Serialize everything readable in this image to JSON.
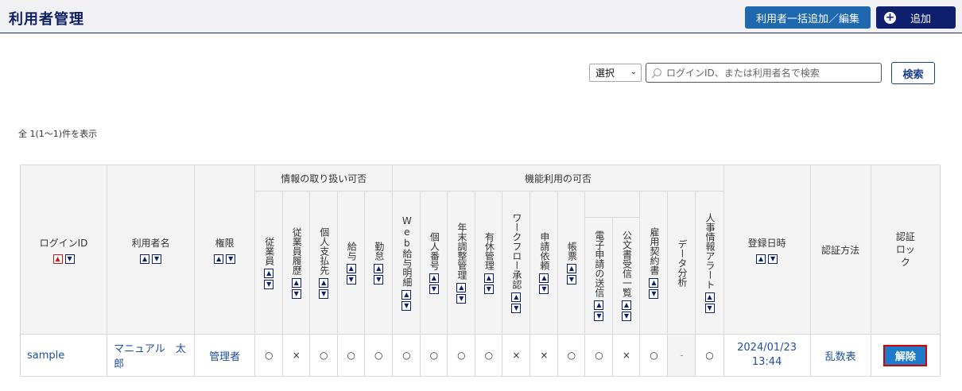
{
  "header": {
    "title": "利用者管理",
    "bulk_button": "利用者一括追加／編集",
    "add_button": "追加",
    "add_icon": "plus-circle-icon"
  },
  "search": {
    "select_value": "選択",
    "placeholder": "ログインID、または利用者名で検索",
    "button": "検索"
  },
  "result_count": "全 1(1〜1)件を表示",
  "table": {
    "group_info": "情報の取り扱い可否",
    "group_func": "機能利用の可否",
    "cols": {
      "login_id": "ログインID",
      "user_name": "利用者名",
      "role": "権限",
      "employee": "従業員",
      "employee_history": "従業員履歴",
      "payee": "個人支払先",
      "salary": "給与",
      "attendance": "勤怠",
      "web_payslip": "Web給与明細",
      "my_number": "個人番号",
      "year_end": "年末調整管理",
      "paid_leave": "有休管理",
      "workflow": "ワークフロー承認",
      "request": "申請依頼",
      "forms": "帳票",
      "e_filing": "電子申請の送信",
      "official_doc": "公文書受信一覧",
      "contract": "雇用契約書",
      "data_analysis": "データ分析",
      "hr_alert": "人事情報アラート",
      "registered": "登録日時",
      "auth_method": "認証方法",
      "auth_lock": "認証ロック"
    },
    "sort_up": "▲",
    "sort_down": "▼",
    "rows": [
      {
        "login_id": "sample",
        "user_name": "マニュアル　太郎",
        "role": "管理者",
        "employee": "○",
        "employee_history": "×",
        "payee": "○",
        "salary": "○",
        "attendance": "○",
        "web_payslip": "○",
        "my_number": "○",
        "year_end": "○",
        "paid_leave": "○",
        "workflow": "×",
        "request": "×",
        "forms": "○",
        "e_filing": "○",
        "official_doc": "×",
        "contract": "○",
        "data_analysis": "-",
        "hr_alert": "○",
        "registered": "2024/01/23 13:44",
        "auth_method": "乱数表",
        "unlock_button": "解除"
      }
    ]
  }
}
